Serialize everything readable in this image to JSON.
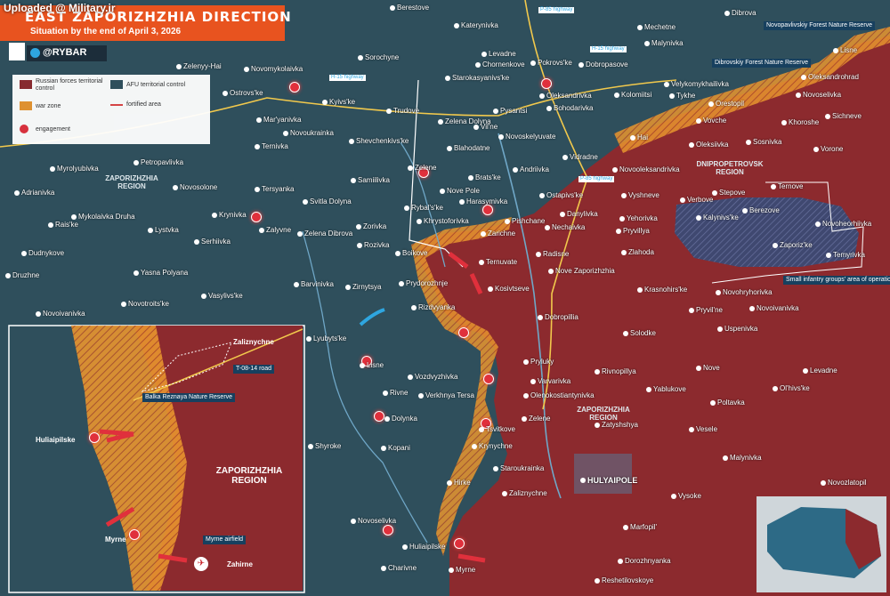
{
  "title": "EAST ZAPORIZHZHIA DIRECTION",
  "subtitle": "Situation by the end of April 3, 2026",
  "upload_note": "Uploaded @ Military.ir",
  "brand": "@RYBAR",
  "legend": {
    "russian": "Russian forces territorial control",
    "afu": "AFU territorial control",
    "war_zone": "war zone",
    "fortified": "fortified area",
    "engagement": "engagement"
  },
  "colors": {
    "russian_control": "#8c2a2e",
    "afu_control": "#2f4f5c",
    "war_zone": "#e8952e",
    "engagement": "#e0303c",
    "title_bar": "#e8531f"
  },
  "regions": {
    "zap_left": "ZAPORIZHZHIA REGION",
    "zap_center": "ZAPORIZHZHIA REGION",
    "dnipro": "DNIPROPETROVSK REGION",
    "inset": "ZAPORIZHZHIA REGION"
  },
  "highways": {
    "p85_top": "P-85 highway",
    "h15_top": "H-15 highway",
    "h15_left": "H-15 highway",
    "p85_mid": "P-85 highway",
    "t0814": "T-08-14 road"
  },
  "notes": {
    "novopavlivsky": "Novopavlivskiy Forest Nature Reserve",
    "dibrovsky": "Dibrovskiy Forest Nature Reserve",
    "small_infantry": "Small infantry groups' area of operations",
    "balka": "Balka Reznaya Nature Reserve",
    "myrne_airfield": "Myrne airfield"
  },
  "places": [
    {
      "id": "berestove",
      "name": "Berestove"
    },
    {
      "id": "dibrova",
      "name": "Dibrova"
    },
    {
      "id": "katerynivka",
      "name": "Katerynivka"
    },
    {
      "id": "mechetne",
      "name": "Mechetne"
    },
    {
      "id": "malynivka_top",
      "name": "Malynivka"
    },
    {
      "id": "sorochyne",
      "name": "Sorochyne"
    },
    {
      "id": "levadne",
      "name": "Levadne"
    },
    {
      "id": "chornenkove",
      "name": "Chornenkove"
    },
    {
      "id": "rokrovske",
      "name": "Pokrovs'ke"
    },
    {
      "id": "dobropasove",
      "name": "Dobropasove"
    },
    {
      "id": "lisne",
      "name": "Lisne"
    },
    {
      "id": "zelenyi_hai",
      "name": "Zelenyy-Hai"
    },
    {
      "id": "novomykolaivka",
      "name": "Novomykolaivka"
    },
    {
      "id": "starokasyanivka",
      "name": "Starokasyanivs'ke"
    },
    {
      "id": "velykomykhailivka",
      "name": "Velykomykhailivka"
    },
    {
      "id": "oleksandrohrad",
      "name": "Oleksandrohrad"
    },
    {
      "id": "ostrovske",
      "name": "Ostrovs'ke"
    },
    {
      "id": "kyivske",
      "name": "Kyivs'ke"
    },
    {
      "id": "trudove",
      "name": "Trudove"
    },
    {
      "id": "pysantsi",
      "name": "Pysantsi"
    },
    {
      "id": "oleksandrivka",
      "name": "Oleksandrivka"
    },
    {
      "id": "kolomiitsi",
      "name": "Kolomiitsi"
    },
    {
      "id": "tykhe",
      "name": "Tykhe"
    },
    {
      "id": "bohodarivka",
      "name": "Bohodarivka"
    },
    {
      "id": "orestopil",
      "name": "Orestopil"
    },
    {
      "id": "maryanivka",
      "name": "Mar'yanivka"
    },
    {
      "id": "zelena_dolyna",
      "name": "Zelena Dolyna"
    },
    {
      "id": "vilne",
      "name": "Vil'ne"
    },
    {
      "id": "vovche",
      "name": "Vovche"
    },
    {
      "id": "khoroshe",
      "name": "Khoroshe"
    },
    {
      "id": "sichneve",
      "name": "Sichneve"
    },
    {
      "id": "novoukrainka",
      "name": "Novoukrainka"
    },
    {
      "id": "novoselivka_n",
      "name": "Novoselivka"
    },
    {
      "id": "novoskelyuvate",
      "name": "Novoskelyuvate"
    },
    {
      "id": "hai",
      "name": "Hai"
    },
    {
      "id": "shevchenkivske",
      "name": "Shevchenkivs'ke"
    },
    {
      "id": "blahodatne",
      "name": "Blahodatne"
    },
    {
      "id": "ternivka",
      "name": "Ternivka"
    },
    {
      "id": "oleksiivka",
      "name": "Oleksiivka"
    },
    {
      "id": "sosnivka",
      "name": "Sosnivka"
    },
    {
      "id": "vorone",
      "name": "Vorone"
    },
    {
      "id": "vidradne",
      "name": "Vidradne"
    },
    {
      "id": "myrolyubivka",
      "name": "Myrolyubivka"
    },
    {
      "id": "petropavlivka",
      "name": "Petropavlivka"
    },
    {
      "id": "zelene_n",
      "name": "Zelene"
    },
    {
      "id": "andriivka",
      "name": "Andriivka"
    },
    {
      "id": "novooleksandrivka",
      "name": "Novooleksandrivka"
    },
    {
      "id": "samiilivka",
      "name": "Samiilivka"
    },
    {
      "id": "bratske",
      "name": "Brats'ke"
    },
    {
      "id": "adrianivka",
      "name": "Adrianivka"
    },
    {
      "id": "novosolone",
      "name": "Novosolone"
    },
    {
      "id": "tersyanka",
      "name": "Tersyanka"
    },
    {
      "id": "nove_pole",
      "name": "Nove Pole"
    },
    {
      "id": "ostapivske",
      "name": "Ostapivs'ke"
    },
    {
      "id": "vyshneve",
      "name": "Vyshneve"
    },
    {
      "id": "verbove",
      "name": "Verbove"
    },
    {
      "id": "stepove",
      "name": "Stepove"
    },
    {
      "id": "ternove",
      "name": "Ternove"
    },
    {
      "id": "svitla_dolyna",
      "name": "Svitla Dolyna"
    },
    {
      "id": "rybalske",
      "name": "Rybal's'ke"
    },
    {
      "id": "harasymivka",
      "name": "Harasymivka"
    },
    {
      "id": "krynivka",
      "name": "Krynivka"
    },
    {
      "id": "mykolaivka_druha",
      "name": "Mykolaivka Druha"
    },
    {
      "id": "zorivka",
      "name": "Zorivka"
    },
    {
      "id": "khrystoforivka",
      "name": "Khrystoforivka"
    },
    {
      "id": "pishchane",
      "name": "Pishchane"
    },
    {
      "id": "danylivka",
      "name": "Danylivka"
    },
    {
      "id": "kalynivske",
      "name": "Kalynivs'ke"
    },
    {
      "id": "berezove",
      "name": "Berezove"
    },
    {
      "id": "novoheorhiivka",
      "name": "Novoheorhiivka"
    },
    {
      "id": "yehorivka",
      "name": "Yehorivka"
    },
    {
      "id": "raiske",
      "name": "Rais'ke"
    },
    {
      "id": "lystvka",
      "name": "Lystvka"
    },
    {
      "id": "zalyvne",
      "name": "Zalyvne"
    },
    {
      "id": "zelena_dibrova",
      "name": "Zelena Dibrova"
    },
    {
      "id": "zarichne",
      "name": "Zarichne"
    },
    {
      "id": "nechaivka",
      "name": "Nechaivka"
    },
    {
      "id": "pryvillya",
      "name": "Pryvillya"
    },
    {
      "id": "zaporizke",
      "name": "Zaporiz'ke"
    },
    {
      "id": "serhiivka",
      "name": "Serhiivka"
    },
    {
      "id": "rozivka",
      "name": "Rozivka"
    },
    {
      "id": "zlahoda",
      "name": "Zlahoda"
    },
    {
      "id": "temyrivka",
      "name": "Temyrivka"
    },
    {
      "id": "dudnykove",
      "name": "Dudnykove"
    },
    {
      "id": "boikove",
      "name": "Boikove"
    },
    {
      "id": "ternuvate",
      "name": "Ternuvate"
    },
    {
      "id": "radisne",
      "name": "Radisne"
    },
    {
      "id": "yasna_polyana",
      "name": "Yasna Polyana"
    },
    {
      "id": "nove_zaporizhzhia",
      "name": "Nove Zaporizhzhia"
    },
    {
      "id": "druzhne",
      "name": "Druzhne"
    },
    {
      "id": "zirnytsya",
      "name": "Zirnytsya"
    },
    {
      "id": "prydorozhnje",
      "name": "Prydorozhnje"
    },
    {
      "id": "kosivtseve",
      "name": "Kosivtseve"
    },
    {
      "id": "krasnohirske",
      "name": "Krasnohirs'ke"
    },
    {
      "id": "novotroitske",
      "name": "Novotroits'ke"
    },
    {
      "id": "barvinivka",
      "name": "Barvinivka"
    },
    {
      "id": "vasylivske",
      "name": "Vasylivs'ke"
    },
    {
      "id": "novohryhorivka",
      "name": "Novohryhorivka"
    },
    {
      "id": "novoivanivka_w",
      "name": "Novoivanivka"
    },
    {
      "id": "rizdvyanka",
      "name": "Rizdvyanka"
    },
    {
      "id": "dobropillia",
      "name": "Dobropillia"
    },
    {
      "id": "novoivanivka_e",
      "name": "Novoivanivka"
    },
    {
      "id": "pryvilne",
      "name": "Pryvil'ne"
    },
    {
      "id": "lyubytske",
      "name": "Lyubyts'ke"
    },
    {
      "id": "uspenivka",
      "name": "Uspenivka"
    },
    {
      "id": "solodke",
      "name": "Solodke"
    },
    {
      "id": "lisne_s",
      "name": "Lisne"
    },
    {
      "id": "vozdvyzhivka",
      "name": "Vozdvyzhivka"
    },
    {
      "id": "pryluky",
      "name": "Pryluky"
    },
    {
      "id": "rivnopillya",
      "name": "Rivnopillya"
    },
    {
      "id": "nove",
      "name": "Nove"
    },
    {
      "id": "levadne_e",
      "name": "Levadne"
    },
    {
      "id": "varvarivka",
      "name": "Varvarivka"
    },
    {
      "id": "yablukove",
      "name": "Yablukove"
    },
    {
      "id": "olhivske",
      "name": "Ol'hivs'ke"
    },
    {
      "id": "rivne",
      "name": "Rivne"
    },
    {
      "id": "olenokostiantynivka",
      "name": "Olenokostiantynivka"
    },
    {
      "id": "zelene_s",
      "name": "Zelene"
    },
    {
      "id": "poltavka",
      "name": "Poltavka"
    },
    {
      "id": "dolynka",
      "name": "Dolynka"
    },
    {
      "id": "verkhnya_tersa",
      "name": "Verkhnya Tersa"
    },
    {
      "id": "tsvitkove",
      "name": "Tsvitkove"
    },
    {
      "id": "zatyshshya",
      "name": "Zatyshshya"
    },
    {
      "id": "veselc",
      "name": "Vesele"
    },
    {
      "id": "shyroke",
      "name": "Shyroke"
    },
    {
      "id": "kopani",
      "name": "Kopani"
    },
    {
      "id": "krynychne",
      "name": "Krynychne"
    },
    {
      "id": "malynivka_s",
      "name": "Malynivka"
    },
    {
      "id": "staroukrainka",
      "name": "Staroukrainka"
    },
    {
      "id": "hirke",
      "name": "Hirke"
    },
    {
      "id": "huliaipole",
      "name": "HULYAIPOLE"
    },
    {
      "id": "novozlatopil",
      "name": "Novozlatopil"
    },
    {
      "id": "zaliznychne_main",
      "name": "Zaliznychne"
    },
    {
      "id": "vysoke",
      "name": "Vysoke"
    },
    {
      "id": "novoselivka_s",
      "name": "Novoselivka"
    },
    {
      "id": "marfopil",
      "name": "Marfopil'"
    },
    {
      "id": "huliaipilske_main",
      "name": "Huliaipilske"
    },
    {
      "id": "myrne_main",
      "name": "Myrne"
    },
    {
      "id": "charivne",
      "name": "Charivne"
    },
    {
      "id": "dorozhnyanka",
      "name": "Dorozhnyanka"
    },
    {
      "id": "reshetylovskoye",
      "name": "Reshetilovskoye"
    }
  ],
  "inset_places": {
    "zaliznychne": "Zaliznychne",
    "huliaipilske": "Huliaipilske",
    "myrne": "Myrne",
    "zahirne": "Zahirne"
  }
}
